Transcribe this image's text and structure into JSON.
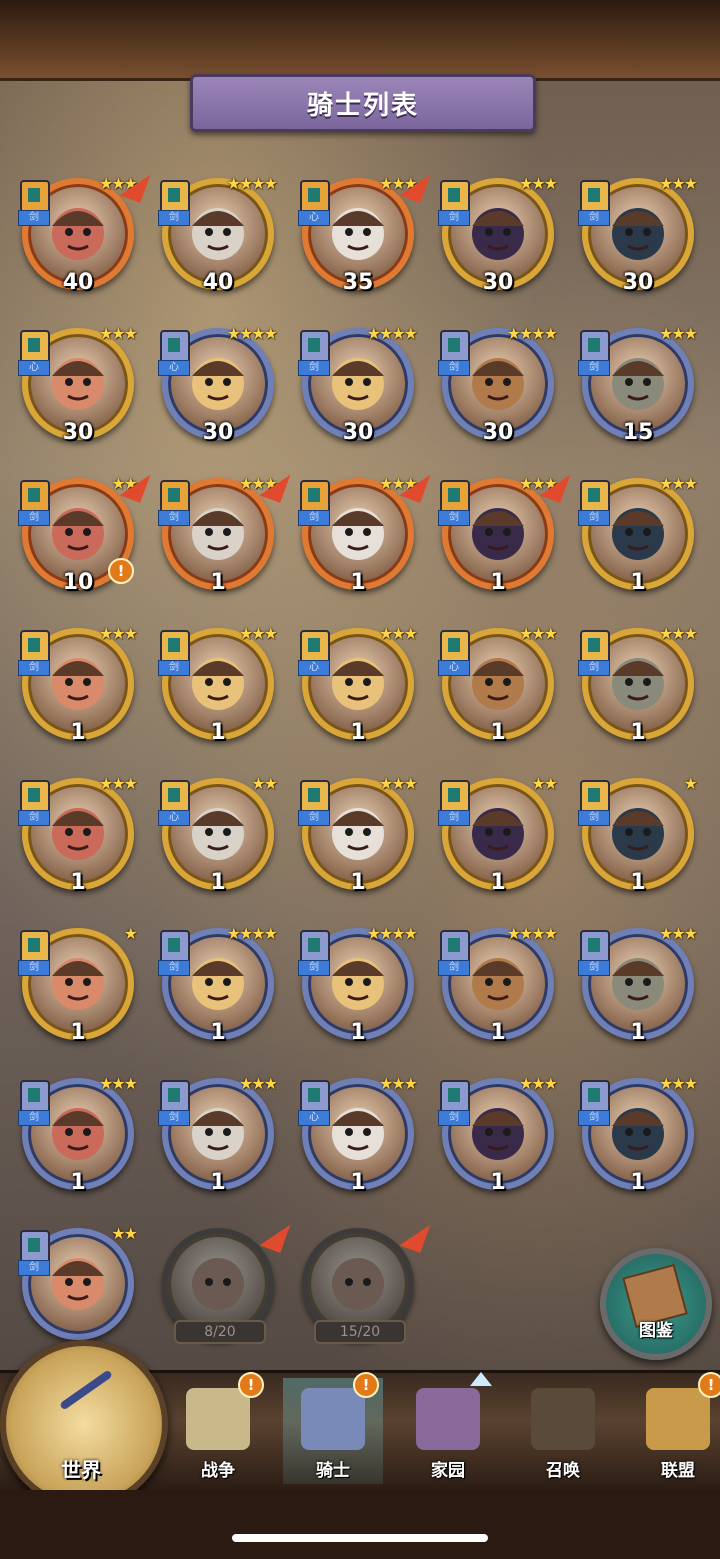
{
  "title": "骑士列表",
  "knights": [
    {
      "level": "40",
      "frame": "orange",
      "stars": "★★★",
      "badge": "orange",
      "type": "剑",
      "ribbon": true,
      "alert": false
    },
    {
      "level": "40",
      "frame": "gold",
      "stars": "★★★★",
      "badge": "gold",
      "type": "剑",
      "ribbon": false,
      "alert": false
    },
    {
      "level": "35",
      "frame": "orange",
      "stars": "★★★",
      "badge": "orange",
      "type": "心",
      "ribbon": true,
      "alert": false
    },
    {
      "level": "30",
      "frame": "gold",
      "stars": "★★★",
      "badge": "gold",
      "type": "剑",
      "ribbon": false,
      "alert": false
    },
    {
      "level": "30",
      "frame": "gold",
      "stars": "★★★",
      "badge": "gold",
      "type": "剑",
      "ribbon": false,
      "alert": false
    },
    {
      "level": "30",
      "frame": "gold",
      "stars": "★★★",
      "badge": "gold",
      "type": "心",
      "ribbon": false,
      "alert": false
    },
    {
      "level": "30",
      "frame": "blue",
      "stars": "★★★★",
      "badge": "blue",
      "type": "心",
      "ribbon": false,
      "alert": false
    },
    {
      "level": "30",
      "frame": "blue",
      "stars": "★★★★",
      "badge": "blue",
      "type": "剑",
      "ribbon": false,
      "alert": false
    },
    {
      "level": "30",
      "frame": "blue",
      "stars": "★★★★",
      "badge": "blue",
      "type": "剑",
      "ribbon": false,
      "alert": false
    },
    {
      "level": "15",
      "frame": "blue",
      "stars": "★★★",
      "badge": "blue",
      "type": "剑",
      "ribbon": false,
      "alert": false
    },
    {
      "level": "10",
      "frame": "orange",
      "stars": "★★",
      "badge": "orange",
      "type": "剑",
      "ribbon": true,
      "alert": true
    },
    {
      "level": "1",
      "frame": "orange",
      "stars": "★★★",
      "badge": "orange",
      "type": "剑",
      "ribbon": true,
      "alert": false
    },
    {
      "level": "1",
      "frame": "orange",
      "stars": "★★★",
      "badge": "orange",
      "type": "剑",
      "ribbon": true,
      "alert": false
    },
    {
      "level": "1",
      "frame": "orange",
      "stars": "★★★",
      "badge": "orange",
      "type": "剑",
      "ribbon": true,
      "alert": false
    },
    {
      "level": "1",
      "frame": "gold",
      "stars": "★★★",
      "badge": "gold",
      "type": "剑",
      "ribbon": false,
      "alert": false
    },
    {
      "level": "1",
      "frame": "gold",
      "stars": "★★★",
      "badge": "gold",
      "type": "剑",
      "ribbon": false,
      "alert": false
    },
    {
      "level": "1",
      "frame": "gold",
      "stars": "★★★",
      "badge": "gold",
      "type": "剑",
      "ribbon": false,
      "alert": false
    },
    {
      "level": "1",
      "frame": "gold",
      "stars": "★★★",
      "badge": "gold",
      "type": "心",
      "ribbon": false,
      "alert": false
    },
    {
      "level": "1",
      "frame": "gold",
      "stars": "★★★",
      "badge": "gold",
      "type": "心",
      "ribbon": false,
      "alert": false
    },
    {
      "level": "1",
      "frame": "gold",
      "stars": "★★★",
      "badge": "gold",
      "type": "剑",
      "ribbon": false,
      "alert": false
    },
    {
      "level": "1",
      "frame": "gold",
      "stars": "★★★",
      "badge": "gold",
      "type": "剑",
      "ribbon": false,
      "alert": false
    },
    {
      "level": "1",
      "frame": "gold",
      "stars": "★★",
      "badge": "gold",
      "type": "心",
      "ribbon": false,
      "alert": false
    },
    {
      "level": "1",
      "frame": "gold",
      "stars": "★★★",
      "badge": "gold",
      "type": "剑",
      "ribbon": false,
      "alert": false
    },
    {
      "level": "1",
      "frame": "gold",
      "stars": "★★",
      "badge": "gold",
      "type": "剑",
      "ribbon": false,
      "alert": false
    },
    {
      "level": "1",
      "frame": "gold",
      "stars": "★",
      "badge": "gold",
      "type": "剑",
      "ribbon": false,
      "alert": false
    },
    {
      "level": "1",
      "frame": "gold",
      "stars": "★",
      "badge": "gold",
      "type": "剑",
      "ribbon": false,
      "alert": false
    },
    {
      "level": "1",
      "frame": "blue",
      "stars": "★★★★",
      "badge": "blue",
      "type": "剑",
      "ribbon": false,
      "alert": false
    },
    {
      "level": "1",
      "frame": "blue",
      "stars": "★★★★",
      "badge": "blue",
      "type": "剑",
      "ribbon": false,
      "alert": false
    },
    {
      "level": "1",
      "frame": "blue",
      "stars": "★★★★",
      "badge": "blue",
      "type": "剑",
      "ribbon": false,
      "alert": false
    },
    {
      "level": "1",
      "frame": "blue",
      "stars": "★★★",
      "badge": "blue",
      "type": "剑",
      "ribbon": false,
      "alert": false
    },
    {
      "level": "1",
      "frame": "blue",
      "stars": "★★★",
      "badge": "blue",
      "type": "剑",
      "ribbon": false,
      "alert": false
    },
    {
      "level": "1",
      "frame": "blue",
      "stars": "★★★",
      "badge": "blue",
      "type": "剑",
      "ribbon": false,
      "alert": false
    },
    {
      "level": "1",
      "frame": "blue",
      "stars": "★★★",
      "badge": "blue",
      "type": "心",
      "ribbon": false,
      "alert": false
    },
    {
      "level": "1",
      "frame": "blue",
      "stars": "★★★",
      "badge": "blue",
      "type": "剑",
      "ribbon": false,
      "alert": false
    },
    {
      "level": "1",
      "frame": "blue",
      "stars": "★★★",
      "badge": "blue",
      "type": "剑",
      "ribbon": false,
      "alert": false
    },
    {
      "level": "",
      "frame": "blue",
      "stars": "★★",
      "badge": "blue",
      "type": "剑",
      "ribbon": false,
      "alert": false
    }
  ],
  "locked": [
    {
      "progress": "8/20"
    },
    {
      "progress": "15/20"
    }
  ],
  "collection_button": {
    "label": "图鉴"
  },
  "nav": {
    "world": "世界",
    "tabs": [
      {
        "label": "战争",
        "alert": true,
        "active": false
      },
      {
        "label": "骑士",
        "alert": true,
        "active": true
      },
      {
        "label": "家园",
        "alert": false,
        "active": false
      },
      {
        "label": "召唤",
        "alert": false,
        "active": false
      },
      {
        "label": "联盟",
        "alert": true,
        "active": false
      }
    ]
  },
  "alert_symbol": "!"
}
